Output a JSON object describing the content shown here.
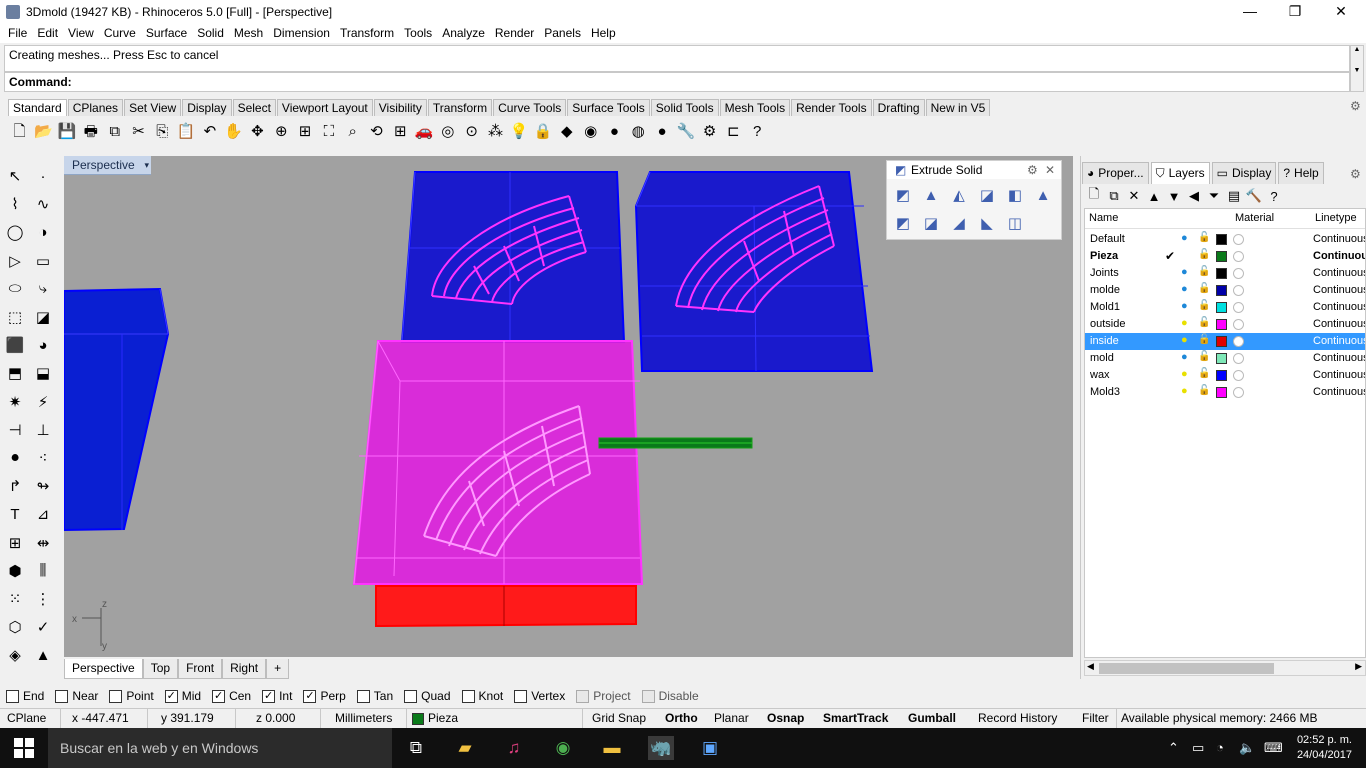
{
  "window": {
    "title": "3Dmold (19427 KB) - Rhinoceros 5.0 [Full] - [Perspective]",
    "minimize": "—",
    "maximize": "❐",
    "close": "✕"
  },
  "menu": [
    "File",
    "Edit",
    "View",
    "Curve",
    "Surface",
    "Solid",
    "Mesh",
    "Dimension",
    "Transform",
    "Tools",
    "Analyze",
    "Render",
    "Panels",
    "Help"
  ],
  "command": {
    "history": "Creating meshes... Press Esc to cancel",
    "prompt": "Command:"
  },
  "toolbar_tabs": [
    "Standard",
    "CPlanes",
    "Set View",
    "Display",
    "Select",
    "Viewport Layout",
    "Visibility",
    "Transform",
    "Curve Tools",
    "Surface Tools",
    "Solid Tools",
    "Mesh Tools",
    "Render Tools",
    "Drafting",
    "New in V5"
  ],
  "toolbar_icons": [
    "new-file-icon",
    "open-folder-icon",
    "save-icon",
    "print-icon",
    "import-icon",
    "cut-icon",
    "copy-icon",
    "paste-icon",
    "undo-icon",
    "pan-hand-icon",
    "rotate-view-icon",
    "zoom-dynamic-icon",
    "zoom-window-icon",
    "zoom-extents-icon",
    "zoom-selected-icon",
    "rotate-3d-icon",
    "four-viewports-icon",
    "car-icon",
    "perspective-icon",
    "target-icon",
    "points-icon",
    "light-bulb-icon",
    "lock-icon",
    "material-icon",
    "color-wheel-icon",
    "sphere-gray-icon",
    "sphere-silver-icon",
    "sphere-blue-icon",
    "wrench-icon",
    "gear-icon",
    "extend-icon",
    "help-icon"
  ],
  "toolbar_glyphs": [
    "🗋",
    "📂",
    "💾",
    "🖶",
    "⧉",
    "✂",
    "⎘",
    "📋",
    "↶",
    "✋",
    "✥",
    "⊕",
    "⊞",
    "⛶",
    "⌕",
    "⟲",
    "⊞",
    "🚗",
    "◎",
    "⊙",
    "⁂",
    "💡",
    "🔒",
    "◆",
    "◉",
    "●",
    "◍",
    "●",
    "🔧",
    "⚙",
    "⊏",
    "?"
  ],
  "left_toolbar": [
    {
      "icon": "select-arrow-icon",
      "glyph": "↖"
    },
    {
      "icon": "point-icon",
      "glyph": "·"
    },
    {
      "icon": "polyline-icon",
      "glyph": "⌇"
    },
    {
      "icon": "curve-icon",
      "glyph": "∿"
    },
    {
      "icon": "circle-icon",
      "glyph": "◯"
    },
    {
      "icon": "arc-icon",
      "glyph": "◑"
    },
    {
      "icon": "polygon-icon",
      "glyph": "▷"
    },
    {
      "icon": "rectangle-icon",
      "glyph": "▭"
    },
    {
      "icon": "ellipse-icon",
      "glyph": "⬭"
    },
    {
      "icon": "fillet-curve-icon",
      "glyph": "⤷"
    },
    {
      "icon": "surface-icon",
      "glyph": "⬚"
    },
    {
      "icon": "loft-icon",
      "glyph": "◪"
    },
    {
      "icon": "box-icon",
      "glyph": "⬛"
    },
    {
      "icon": "boolean-icon",
      "glyph": "◕"
    },
    {
      "icon": "mesh-icon",
      "glyph": "⬒"
    },
    {
      "icon": "mesh-surface-icon",
      "glyph": "⬓"
    },
    {
      "icon": "explode-icon",
      "glyph": "✷"
    },
    {
      "icon": "trim-icon",
      "glyph": "⚡"
    },
    {
      "icon": "split-icon",
      "glyph": "⊣"
    },
    {
      "icon": "join-icon",
      "glyph": "⊥"
    },
    {
      "icon": "group-icon",
      "glyph": "⚫"
    },
    {
      "icon": "points-on-icon",
      "glyph": "⁖"
    },
    {
      "icon": "fillet-icon",
      "glyph": "↱"
    },
    {
      "icon": "offset-icon",
      "glyph": "↬"
    },
    {
      "icon": "text-icon",
      "glyph": "T"
    },
    {
      "icon": "dimension-icon",
      "glyph": "⊿"
    },
    {
      "icon": "array-icon",
      "glyph": "⊞"
    },
    {
      "icon": "mirror-icon",
      "glyph": "⇹"
    },
    {
      "icon": "block-icon",
      "glyph": "⬢"
    },
    {
      "icon": "gumball-icon",
      "glyph": "⫼"
    },
    {
      "icon": "grid-array-icon",
      "glyph": "⁙"
    },
    {
      "icon": "history-icon",
      "glyph": "⋮"
    },
    {
      "icon": "analyze-icon",
      "glyph": "⬡"
    },
    {
      "icon": "check-icon",
      "glyph": "✓"
    },
    {
      "icon": "render-icon",
      "glyph": "◈"
    },
    {
      "icon": "paint-icon",
      "glyph": "▲"
    }
  ],
  "viewport": {
    "title": "Perspective",
    "dropdown": "▾"
  },
  "extrude_panel": {
    "title": "Extrude Solid",
    "gear": "⚙",
    "close": "✕",
    "glyphs": [
      "◩",
      "▲",
      "◭",
      "◪",
      "◧",
      "▲",
      "◩",
      "◪",
      "◢",
      "◣",
      "◫"
    ]
  },
  "viewport_tabs": [
    "Perspective",
    "Top",
    "Front",
    "Right",
    "+"
  ],
  "right_panel": {
    "tabs": [
      {
        "label": "Proper...",
        "icon": "properties-icon",
        "glyph": "◕"
      },
      {
        "label": "Layers",
        "icon": "layers-icon",
        "glyph": "⛉"
      },
      {
        "label": "Display",
        "icon": "display-icon",
        "glyph": "▭"
      },
      {
        "label": "Help",
        "icon": "help-icon",
        "glyph": "?"
      }
    ],
    "toolbar": [
      {
        "icon": "new-layer-icon",
        "glyph": "🗋"
      },
      {
        "icon": "new-sublayer-icon",
        "glyph": "⧉"
      },
      {
        "icon": "delete-icon",
        "glyph": "✕"
      },
      {
        "icon": "move-up-icon",
        "glyph": "▲"
      },
      {
        "icon": "move-down-icon",
        "glyph": "▼"
      },
      {
        "icon": "move-parent-icon",
        "glyph": "◀"
      },
      {
        "icon": "filter-icon",
        "glyph": "⏷"
      },
      {
        "icon": "layer-props-icon",
        "glyph": "▤"
      },
      {
        "icon": "tools-icon",
        "glyph": "🔨"
      },
      {
        "icon": "help-icon",
        "glyph": "?"
      }
    ],
    "columns": {
      "name": "Name",
      "material": "Material",
      "linetype": "Linetype"
    },
    "layers": [
      {
        "name": "Default",
        "color": "#000000",
        "linetype": "Continuous",
        "current": false,
        "selected": false,
        "bulb": "#1e88d8",
        "bold": false
      },
      {
        "name": "Pieza",
        "color": "#0a7a1a",
        "linetype": "Continuou",
        "current": true,
        "selected": false,
        "bulb": "",
        "bold": true
      },
      {
        "name": "Joints",
        "color": "#000000",
        "linetype": "Continuous",
        "current": false,
        "selected": false,
        "bulb": "#1e88d8",
        "bold": false
      },
      {
        "name": "molde",
        "color": "#0000a8",
        "linetype": "Continuous",
        "current": false,
        "selected": false,
        "bulb": "#1e88d8",
        "bold": false
      },
      {
        "name": "Mold1",
        "color": "#00e0e0",
        "linetype": "Continuous",
        "current": false,
        "selected": false,
        "bulb": "#1e88d8",
        "bold": false
      },
      {
        "name": "outside",
        "color": "#ff00ff",
        "linetype": "Continuous",
        "current": false,
        "selected": false,
        "bulb": "#e8e000",
        "bold": false
      },
      {
        "name": "inside",
        "color": "#e00000",
        "linetype": "Continuous",
        "current": false,
        "selected": true,
        "bulb": "#e8e000",
        "bold": false
      },
      {
        "name": "mold",
        "color": "#7fe8b8",
        "linetype": "Continuous",
        "current": false,
        "selected": false,
        "bulb": "#1e88d8",
        "bold": false
      },
      {
        "name": "wax",
        "color": "#0000ff",
        "linetype": "Continuous",
        "current": false,
        "selected": false,
        "bulb": "#e8e000",
        "bold": false
      },
      {
        "name": "Mold3",
        "color": "#ff00ff",
        "linetype": "Continuous",
        "current": false,
        "selected": false,
        "bulb": "#e8e000",
        "bold": false
      }
    ]
  },
  "osnaps": [
    {
      "label": "End",
      "checked": false
    },
    {
      "label": "Near",
      "checked": false
    },
    {
      "label": "Point",
      "checked": false
    },
    {
      "label": "Mid",
      "checked": true
    },
    {
      "label": "Cen",
      "checked": true
    },
    {
      "label": "Int",
      "checked": true
    },
    {
      "label": "Perp",
      "checked": true
    },
    {
      "label": "Tan",
      "checked": false
    },
    {
      "label": "Quad",
      "checked": false
    },
    {
      "label": "Knot",
      "checked": false
    },
    {
      "label": "Vertex",
      "checked": false
    },
    {
      "label": "Project",
      "checked": false,
      "disabled": true
    },
    {
      "label": "Disable",
      "checked": false,
      "disabled": true
    }
  ],
  "status": {
    "cplane": "CPlane",
    "x": "x -447.471",
    "y": "y 391.179",
    "z": "z 0.000",
    "units": "Millimeters",
    "layer": "Pieza",
    "layer_color": "#0a7a1a",
    "grid_snap": "Grid Snap",
    "ortho": "Ortho",
    "planar": "Planar",
    "osnap": "Osnap",
    "smarttrack": "SmartTrack",
    "gumball": "Gumball",
    "record_history": "Record History",
    "filter": "Filter",
    "memory": "Available physical memory: 2466 MB"
  },
  "taskbar": {
    "search": "Buscar en la web y en Windows",
    "time": "02:52 p. m.",
    "date": "24/04/2017"
  }
}
